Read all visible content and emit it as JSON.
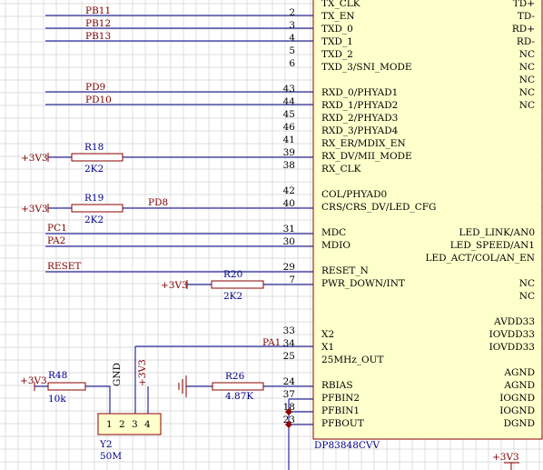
{
  "colors": {
    "background": "#ffffff",
    "grid": "#d2d2d2",
    "wire": "#00008b",
    "net_label": "#800000",
    "part_outline": "#8b0000",
    "chip_fill": "#ffffcc",
    "pin_text": "#000000",
    "designator": "#00008b",
    "junction": "#8b0000"
  },
  "chip": {
    "designator": "DP83848CVV",
    "left_pins": [
      {
        "num": "",
        "name": "TX_CLK"
      },
      {
        "num": "2",
        "name": "TX_EN"
      },
      {
        "num": "3",
        "name": "TXD_0"
      },
      {
        "num": "4",
        "name": "TXD_1"
      },
      {
        "num": "5",
        "name": "TXD_2"
      },
      {
        "num": "6",
        "name": "TXD_3/SNI_MODE"
      },
      {
        "num": "43",
        "name": "RXD_0/PHYAD1"
      },
      {
        "num": "44",
        "name": "RXD_1/PHYAD2"
      },
      {
        "num": "45",
        "name": "RXD_2/PHYAD3"
      },
      {
        "num": "46",
        "name": "RXD_3/PHYAD4"
      },
      {
        "num": "41",
        "name": "RX_ER/MDIX_EN"
      },
      {
        "num": "39",
        "name": "RX_DV/MII_MODE"
      },
      {
        "num": "38",
        "name": "RX_CLK"
      },
      {
        "num": "42",
        "name": "COL/PHYAD0"
      },
      {
        "num": "40",
        "name": "CRS/CRS_DV/LED_CFG"
      },
      {
        "num": "31",
        "name": "MDC"
      },
      {
        "num": "30",
        "name": "MDIO"
      },
      {
        "num": "29",
        "name": "RESET_N"
      },
      {
        "num": "7",
        "name": "PWR_DOWN/INT"
      },
      {
        "num": "33",
        "name": "X2"
      },
      {
        "num": "34",
        "name": "X1"
      },
      {
        "num": "25",
        "name": "25MHz_OUT"
      },
      {
        "num": "24",
        "name": "RBIAS"
      },
      {
        "num": "37",
        "name": "PFBIN2"
      },
      {
        "num": "18",
        "name": "PFBIN1"
      },
      {
        "num": "23",
        "name": "PFBOUT"
      }
    ],
    "right_pins": [
      "TD+",
      "TD-",
      "RD+",
      "RD-",
      "NC",
      "NC",
      "NC",
      "NC",
      "NC",
      "LED_LINK/AN0",
      "LED_SPEED/AN1",
      "LED_ACT/COL/AN_EN",
      "NC",
      "NC",
      "AVDD33",
      "IOVDD33",
      "IOVDD33",
      "AGND",
      "AGND",
      "IOGND",
      "IOGND",
      "DGND"
    ]
  },
  "nets": {
    "pb11": "PB11",
    "pb12": "PB12",
    "pb13": "PB13",
    "pd9": "PD9",
    "pd10": "PD10",
    "pd8": "PD8",
    "pc1": "PC1",
    "pa2": "PA2",
    "reset": "RESET",
    "pa1": "PA1",
    "vcc1": "+3V3",
    "vcc2": "+3V3",
    "vcc3": "+3V3",
    "vcc4": "+3V3",
    "vcc5": "+3V3",
    "vcc6": "+3V3"
  },
  "resistors": {
    "r18": {
      "ref": "R18",
      "value": "2K2"
    },
    "r19": {
      "ref": "R19",
      "value": "2K2"
    },
    "r20": {
      "ref": "R20",
      "value": "2K2"
    },
    "r26": {
      "ref": "R26",
      "value": "4.87K"
    },
    "r48": {
      "ref": "R48",
      "value": "10k"
    }
  },
  "crystal": {
    "ref": "Y2",
    "value": "50M",
    "pin_numbers": [
      "1",
      "2",
      "3",
      "4"
    ],
    "gnd_label": "GND"
  }
}
